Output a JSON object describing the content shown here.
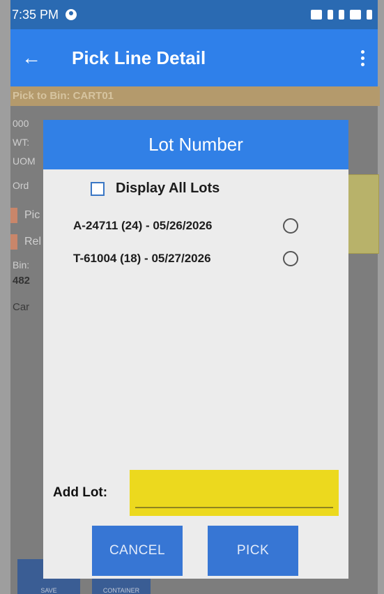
{
  "status_bar": {
    "time": "7:35 PM"
  },
  "app_bar": {
    "title": "Pick Line Detail"
  },
  "background": {
    "pick_to_bin": "Pick to Bin: CART01",
    "lines": [
      "000",
      "WT:",
      "UOM",
      "Ord",
      "Pic",
      "Rel",
      "Bin:",
      "482",
      "Car"
    ],
    "bottom_buttons": [
      "SAVE",
      "CONTAINER"
    ]
  },
  "dialog": {
    "title": "Lot Number",
    "display_all_label": "Display All Lots",
    "lots": [
      {
        "label": "A-24711 (24) - 05/26/2026"
      },
      {
        "label": "T-61004 (18) - 05/27/2026"
      }
    ],
    "add_lot_label": "Add Lot:",
    "add_lot_value": "",
    "cancel_label": "CANCEL",
    "pick_label": "PICK"
  }
}
